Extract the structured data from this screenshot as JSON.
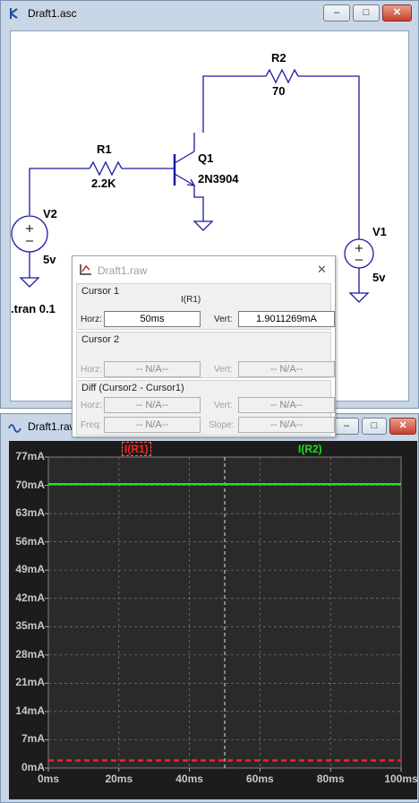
{
  "schematic_window": {
    "title": "Draft1.asc",
    "minimize_glyph": "–",
    "maximize_glyph": "□",
    "close_glyph": "✕"
  },
  "schematic": {
    "r1": {
      "name": "R1",
      "value": "2.2K"
    },
    "r2": {
      "name": "R2",
      "value": "70"
    },
    "q1": {
      "name": "Q1",
      "model": "2N3904"
    },
    "v1": {
      "name": "V1",
      "value": "5v"
    },
    "v2": {
      "name": "V2",
      "value": "5v"
    },
    "directive": ".tran 0.1"
  },
  "cursor_dialog": {
    "title": "Draft1.raw",
    "close_glyph": "✕",
    "cursor1": {
      "label": "Cursor 1",
      "trace": "I(R1)",
      "horz_label": "Horz:",
      "horz_value": "50ms",
      "vert_label": "Vert:",
      "vert_value": "1.9011269mA"
    },
    "cursor2": {
      "label": "Cursor 2",
      "horz_label": "Horz:",
      "horz_value": "-- N/A--",
      "vert_label": "Vert:",
      "vert_value": "-- N/A--"
    },
    "diff": {
      "label": "Diff (Cursor2 - Cursor1)",
      "horz_label": "Horz:",
      "horz_value": "-- N/A--",
      "vert_label": "Vert:",
      "vert_value": "-- N/A--",
      "freq_label": "Freq:",
      "freq_value": "-- N/A--",
      "slope_label": "Slope:",
      "slope_value": "-- N/A--"
    }
  },
  "waveform_window": {
    "title": "Draft1.raw",
    "minimize_glyph": "–",
    "maximize_glyph": "□",
    "close_glyph": "✕"
  },
  "chart_data": {
    "type": "line",
    "x_ticks": [
      "0ms",
      "20ms",
      "40ms",
      "60ms",
      "80ms",
      "100ms"
    ],
    "x_values": [
      0,
      20,
      40,
      60,
      80,
      100
    ],
    "y_ticks": [
      "0mA",
      "7mA",
      "14mA",
      "21mA",
      "28mA",
      "35mA",
      "42mA",
      "49mA",
      "56mA",
      "63mA",
      "70mA",
      "77mA"
    ],
    "y_values": [
      0,
      7,
      14,
      21,
      28,
      35,
      42,
      49,
      56,
      63,
      70,
      77
    ],
    "xlim": [
      0,
      100
    ],
    "ylim": [
      0,
      77
    ],
    "grid": true,
    "cursor_x": 50,
    "series": [
      {
        "name": "I(R1)",
        "color": "#ff2020",
        "dashed": true,
        "x": [
          0,
          100
        ],
        "y": [
          1.9,
          1.9
        ]
      },
      {
        "name": "I(R2)",
        "color": "#20e020",
        "dashed": false,
        "x": [
          0,
          100
        ],
        "y": [
          70.3,
          70.3
        ]
      }
    ]
  }
}
